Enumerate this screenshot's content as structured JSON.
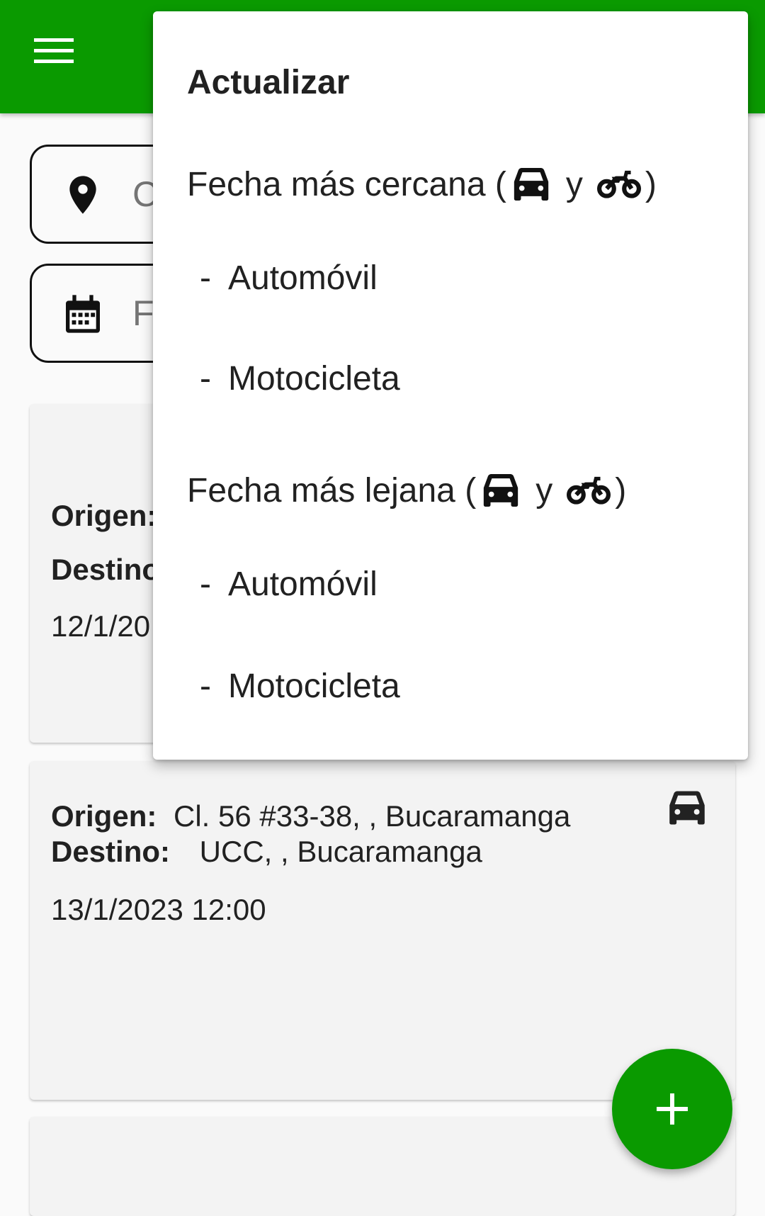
{
  "app_bar": {
    "color": "#0a9a00",
    "menu_icon": "hamburger-icon"
  },
  "search": {
    "location_placeholder": "C",
    "location_icon": "map-pin-icon",
    "date_placeholder": "Fe",
    "date_icon": "calendar-icon"
  },
  "cards": [
    {
      "origin_label": "Origen:",
      "origin_value": "",
      "destination_label": "Destino",
      "destination_value": "",
      "date": "12/1/20",
      "vehicle_icon": "car-icon"
    },
    {
      "origin_label": "Origen:",
      "origin_value": "Cl. 56 #33-38, , Bucaramanga",
      "destination_label": "Destino:",
      "destination_value": "UCC, , Bucaramanga",
      "date": "13/1/2023 12:00",
      "vehicle_icon": "car-icon"
    }
  ],
  "menu": {
    "header": "Actualizar",
    "nearest_label": "Fecha más cercana (",
    "farthest_label": "Fecha más lejana (",
    "conj": "y",
    "close_paren": ")",
    "dash": "-",
    "nearest_car": "Automóvil",
    "nearest_moto": "Motocicleta",
    "farthest_car": "Automóvil",
    "farthest_moto": "Motocicleta"
  },
  "fab": {
    "icon": "plus-icon",
    "color": "#0a9a00"
  }
}
